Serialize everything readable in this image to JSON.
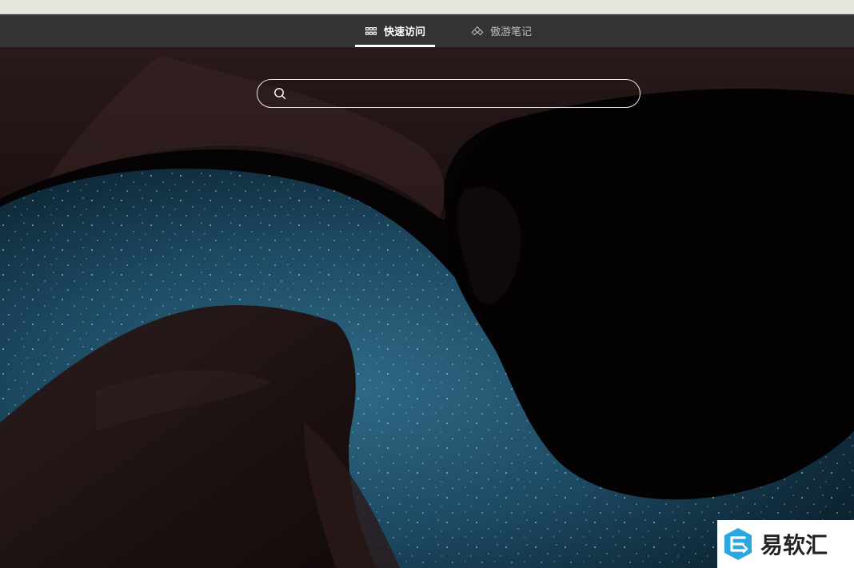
{
  "tabs": [
    {
      "label": "快速访问",
      "icon": "grid-icon",
      "active": true
    },
    {
      "label": "傲游笔记",
      "icon": "notes-icon",
      "active": false
    }
  ],
  "search": {
    "placeholder": "",
    "value": ""
  },
  "watermark": {
    "text": "易软汇"
  },
  "colors": {
    "top_strip": "#e6e8df",
    "tab_bar": "#333333",
    "active_tab_text": "#ffffff",
    "inactive_tab_text": "#bdbdbd",
    "watermark_logo": "#2aa6e0"
  }
}
